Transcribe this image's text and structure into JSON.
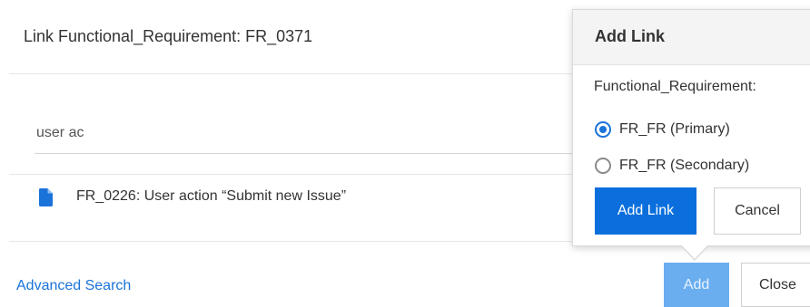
{
  "dialog": {
    "title": "Link Functional_Requirement: FR_0371"
  },
  "search": {
    "value": "user ac"
  },
  "results": [
    {
      "icon": "document-icon",
      "label": "FR_0226: User action “Submit new Issue”"
    }
  ],
  "footer": {
    "advanced_search_label": "Advanced Search",
    "add_label": "Add",
    "close_label": "Close"
  },
  "popover": {
    "title": "Add Link",
    "group_label": "Functional_Requirement:",
    "options": [
      {
        "label": "FR_FR (Primary)",
        "checked": true
      },
      {
        "label": "FR_FR (Secondary)",
        "checked": false
      }
    ],
    "add_link_label": "Add Link",
    "cancel_label": "Cancel"
  },
  "colors": {
    "accent": "#0a6fdc",
    "link": "#1a73d9",
    "disabled_button": "#6aaef0",
    "header_bg": "#f4f4f4"
  }
}
